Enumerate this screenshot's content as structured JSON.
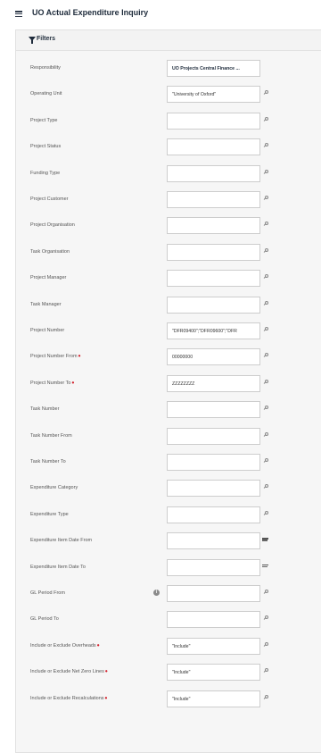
{
  "header": {
    "title": "UO Actual Expenditure Inquiry",
    "icon": "list-icon"
  },
  "filters": {
    "title": "Filters",
    "fields": [
      {
        "label": "Responsibility",
        "value": "UO Projects Central Finance ...",
        "kind": "select",
        "required": false
      },
      {
        "label": "Operating Unit",
        "value": "\"University of Oxford\"",
        "kind": "search",
        "required": false
      },
      {
        "label": "Project Type",
        "value": "",
        "kind": "search",
        "required": false
      },
      {
        "label": "Project Status",
        "value": "",
        "kind": "search",
        "required": false
      },
      {
        "label": "Funding Type",
        "value": "",
        "kind": "search",
        "required": false
      },
      {
        "label": "Project Customer",
        "value": "",
        "kind": "search",
        "required": false
      },
      {
        "label": "Project Organisation",
        "value": "",
        "kind": "search",
        "required": false
      },
      {
        "label": "Task Organisation",
        "value": "",
        "kind": "search",
        "required": false
      },
      {
        "label": "Project Manager",
        "value": "",
        "kind": "search",
        "required": false
      },
      {
        "label": "Task Manager",
        "value": "",
        "kind": "search",
        "required": false
      },
      {
        "label": "Project Number",
        "value": "\"DFR09400\";\"DFR09600\";\"DFR",
        "kind": "search",
        "required": false
      },
      {
        "label": "Project Number From",
        "value": "00000000",
        "kind": "search",
        "required": true
      },
      {
        "label": "Project Number To",
        "value": "ZZZZZZZZ",
        "kind": "search",
        "required": true
      },
      {
        "label": "Task Number",
        "value": "",
        "kind": "search",
        "required": false
      },
      {
        "label": "Task Number From",
        "value": "",
        "kind": "search",
        "required": false
      },
      {
        "label": "Task Number To",
        "value": "",
        "kind": "search",
        "required": false
      },
      {
        "label": "Expenditure Category",
        "value": "",
        "kind": "search",
        "required": false
      },
      {
        "label": "Expenditure Type",
        "value": "",
        "kind": "search",
        "required": false
      },
      {
        "label": "Expenditure Item Date From",
        "value": "",
        "kind": "date",
        "required": false
      },
      {
        "label": "Expenditure Item Date To",
        "value": "",
        "kind": "date",
        "required": false
      },
      {
        "label": "GL Period From",
        "value": "",
        "kind": "search",
        "required": false,
        "info": true
      },
      {
        "label": "GL Period To",
        "value": "",
        "kind": "search",
        "required": false
      },
      {
        "label": "Include or Exclude Overheads",
        "value": "\"Include\"",
        "kind": "search",
        "required": true
      },
      {
        "label": "Include or Exclude Net Zero Lines",
        "value": "\"Include\"",
        "kind": "search",
        "required": true
      },
      {
        "label": "Include or Exclude Recalculations",
        "value": "\"Include\"",
        "kind": "search",
        "required": true
      }
    ]
  },
  "colors": {
    "required": "#d31f2a",
    "title": "#1e2b3b",
    "panel": "#f6f6f6"
  }
}
